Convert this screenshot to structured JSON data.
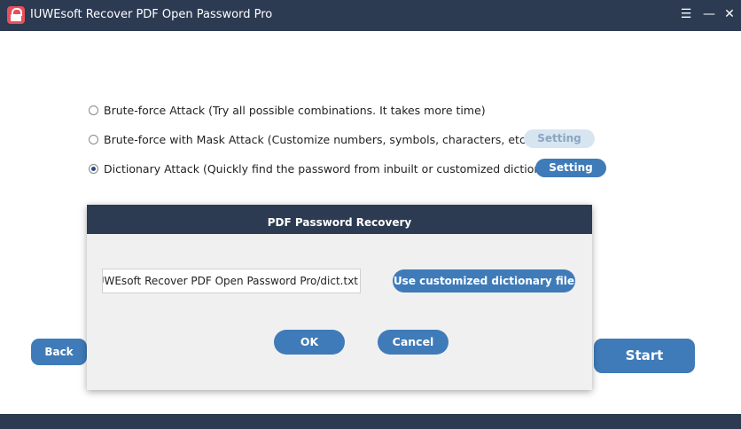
{
  "window": {
    "title": "IUWEsoft Recover PDF Open Password Pro",
    "controls": {
      "menu": "☰",
      "minimize": "—",
      "close": "✕"
    }
  },
  "attack_options": [
    {
      "label": "Brute-force Attack (Try all possible combinations. It takes more time)",
      "selected": false
    },
    {
      "label": "Brute-force with Mask Attack (Customize numbers, symbols, characters, etc.)",
      "selected": false,
      "setting_label": "Setting",
      "setting_enabled": false
    },
    {
      "label": "Dictionary Attack (Quickly find the password from inbuilt or customized dictionary)",
      "selected": true,
      "setting_label": "Setting",
      "setting_enabled": true
    }
  ],
  "footer": {
    "back_label": "Back",
    "start_label": "Start"
  },
  "dialog": {
    "title": "PDF Password Recovery",
    "dictionary_path": "oft/IUWEsoft Recover PDF Open Password Pro/dict.txt",
    "custom_button_label": "Use customized dictionary file",
    "ok_label": "OK",
    "cancel_label": "Cancel"
  },
  "colors": {
    "titlebar": "#2c3a52",
    "accent": "#3f7bb8",
    "disabled_button": "#d7e5f1",
    "app_icon": "#e8505b"
  }
}
